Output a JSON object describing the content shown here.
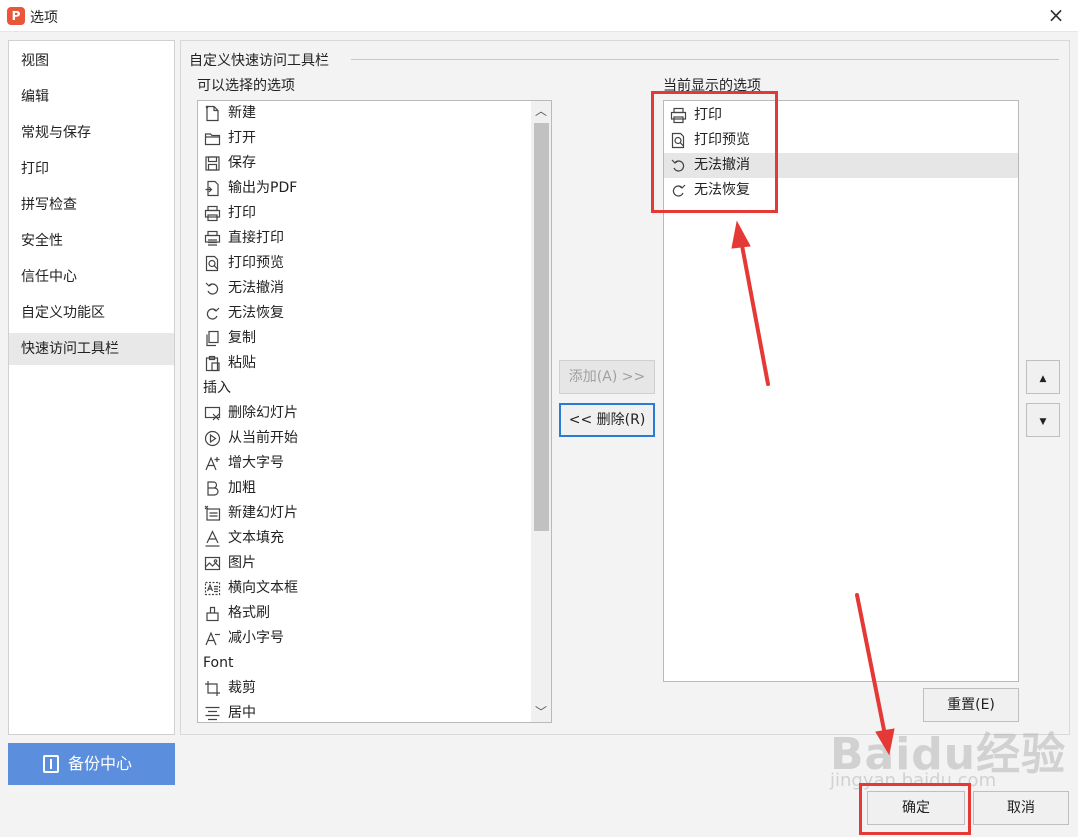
{
  "window": {
    "title": "选项",
    "close_glyph": "×",
    "logo_letter": "P",
    "accent": "#e8573b"
  },
  "nav": {
    "items": [
      "视图",
      "编辑",
      "常规与保存",
      "打印",
      "拼写检查",
      "安全性",
      "信任中心",
      "自定义功能区",
      "快速访问工具栏"
    ],
    "active_index": 8,
    "backup_label": "备份中心"
  },
  "panel": {
    "group_title": "自定义快速访问工具栏",
    "available_label": "可以选择的选项",
    "current_label": "当前显示的选项",
    "available_items": [
      {
        "label": "新建",
        "icon": "new-doc-icon"
      },
      {
        "label": "打开",
        "icon": "folder-icon"
      },
      {
        "label": "保存",
        "icon": "save-icon"
      },
      {
        "label": "输出为PDF",
        "icon": "pdf-export-icon"
      },
      {
        "label": "打印",
        "icon": "printer-icon"
      },
      {
        "label": "直接打印",
        "icon": "direct-print-icon"
      },
      {
        "label": "打印预览",
        "icon": "print-preview-icon"
      },
      {
        "label": "无法撤消",
        "icon": "undo-icon"
      },
      {
        "label": "无法恢复",
        "icon": "redo-icon"
      },
      {
        "label": "复制",
        "icon": "copy-icon"
      },
      {
        "label": "粘贴",
        "icon": "paste-icon"
      },
      {
        "label": "插入",
        "icon": ""
      },
      {
        "label": "删除幻灯片",
        "icon": "delete-slide-icon"
      },
      {
        "label": "从当前开始",
        "icon": "play-icon"
      },
      {
        "label": "增大字号",
        "icon": "font-grow-icon"
      },
      {
        "label": "加粗",
        "icon": "bold-icon"
      },
      {
        "label": "新建幻灯片",
        "icon": "new-slide-icon"
      },
      {
        "label": "文本填充",
        "icon": "text-fill-icon"
      },
      {
        "label": "图片",
        "icon": "image-icon"
      },
      {
        "label": "横向文本框",
        "icon": "textbox-icon"
      },
      {
        "label": "格式刷",
        "icon": "format-painter-icon"
      },
      {
        "label": "减小字号",
        "icon": "font-shrink-icon"
      },
      {
        "label": "Font",
        "icon": ""
      },
      {
        "label": "裁剪",
        "icon": "crop-icon"
      },
      {
        "label": "居中",
        "icon": "align-center-icon"
      }
    ],
    "current_items": [
      {
        "label": "打印",
        "icon": "printer-icon"
      },
      {
        "label": "打印预览",
        "icon": "print-preview-icon"
      },
      {
        "label": "无法撤消",
        "icon": "undo-icon"
      },
      {
        "label": "无法恢复",
        "icon": "redo-icon"
      }
    ],
    "current_selected_index": 2,
    "add_label": "添加(A) >>",
    "remove_label": "<< 删除(R)",
    "up_glyph": "▲",
    "down_glyph": "▼",
    "reset_label": "重置(E)"
  },
  "footer": {
    "ok_label": "确定",
    "cancel_label": "取消"
  },
  "watermark": {
    "brand": "Baidu经验",
    "url": "jingyan.baidu.com"
  },
  "annotation_color": "#e53935",
  "selection_color": "#2a7bd6"
}
